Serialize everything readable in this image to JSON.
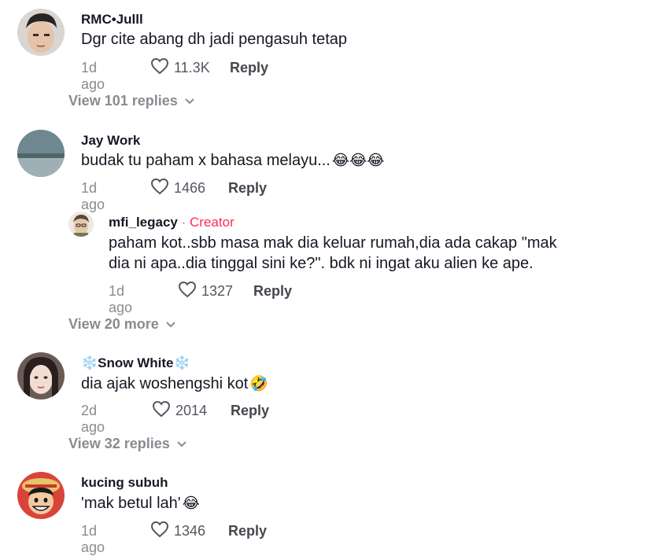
{
  "comments": [
    {
      "username": "RMC•Julll",
      "text": "Dgr cite abang dh jadi pengasuh tetap",
      "date": "1d ago",
      "likes": "11.3K",
      "reply_label": "Reply",
      "view_replies": "View 101 replies"
    },
    {
      "username": "Jay Work",
      "text": "budak tu paham x bahasa melayu...",
      "text_emoji": "😂😂😂",
      "date": "1d ago",
      "likes": "1466",
      "reply_label": "Reply",
      "reply": {
        "username": "mfi_legacy",
        "separator": " · ",
        "badge": "Creator",
        "text_line1": "paham kot..sbb masa mak dia keluar rumah,dia ada cakap \"mak",
        "text_line2": "dia ni apa..dia tinggal sini ke?\". bdk ni ingat aku alien ke ape.",
        "date": "1d ago",
        "likes": "1327",
        "reply_label": "Reply"
      },
      "view_replies": "View 20 more"
    },
    {
      "username_prefix": "❄️",
      "username": "Snow White",
      "username_suffix": "❄️",
      "text": "dia ajak woshengshi kot",
      "text_emoji": "🤣",
      "date": "2d ago",
      "likes": "2014",
      "reply_label": "Reply",
      "view_replies": "View 32 replies"
    },
    {
      "username": "kucing subuh",
      "text": "'mak betul lah'",
      "text_emoji": "😂",
      "date": "1d ago",
      "likes": "1346",
      "reply_label": "Reply"
    }
  ],
  "icons": {
    "like": "heart-outline-icon",
    "expand": "chevron-down-icon"
  },
  "colors": {
    "creator_badge": "#fe2c55",
    "muted_text": "#8a8b91"
  }
}
